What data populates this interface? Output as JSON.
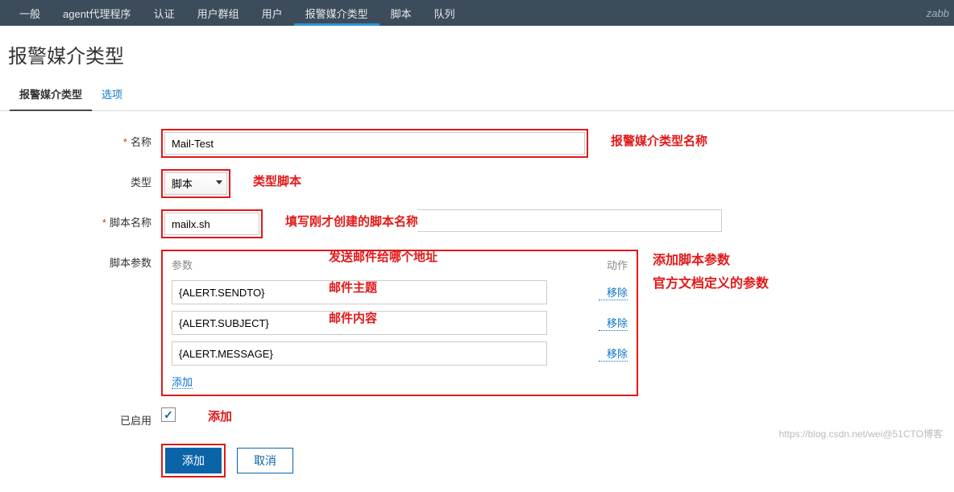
{
  "topnav": {
    "items": [
      "一般",
      "agent代理程序",
      "认证",
      "用户群组",
      "用户",
      "报警媒介类型",
      "脚本",
      "队列"
    ],
    "activeIndex": 5,
    "brand": "zabb"
  },
  "page": {
    "title": "报警媒介类型"
  },
  "tabs": {
    "items": [
      "报警媒介类型",
      "选项"
    ],
    "activeIndex": 0
  },
  "form": {
    "name": {
      "label": "名称",
      "value": "Mail-Test",
      "note": "报警媒介类型名称"
    },
    "type": {
      "label": "类型",
      "value": "脚本",
      "note": "类型脚本"
    },
    "scriptName": {
      "label": "脚本名称",
      "value": "mailx.sh",
      "note": "填写刚才创建的脚本名称"
    },
    "params": {
      "label": "脚本参数",
      "header": {
        "param": "参数",
        "action": "动作"
      },
      "rows": [
        {
          "value": "{ALERT.SENDTO}",
          "note": "发送邮件给哪个地址",
          "action": "移除"
        },
        {
          "value": "{ALERT.SUBJECT}",
          "note": "邮件主题",
          "action": "移除"
        },
        {
          "value": "{ALERT.MESSAGE}",
          "note": "邮件内容",
          "action": "移除"
        }
      ],
      "add": "添加",
      "sideNote1": "添加脚本参数",
      "sideNote2": "官方文档定义的参数"
    },
    "enabled": {
      "label": "已启用",
      "checked": true
    },
    "buttons": {
      "add": "添加",
      "cancel": "取消",
      "addTag": "添加"
    }
  },
  "watermark": "https://blog.csdn.net/wei@51CTO博客"
}
